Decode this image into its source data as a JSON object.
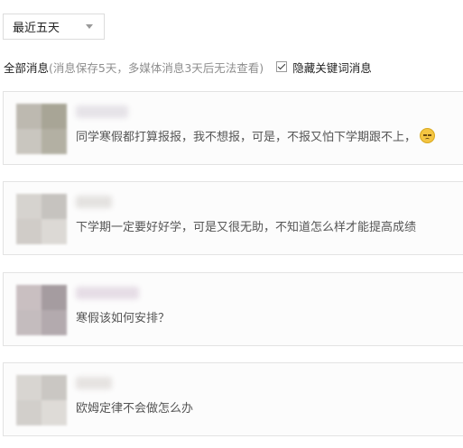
{
  "filter": {
    "time_range": "最近五天",
    "all_messages_label": "全部消息",
    "retention_note": "(消息保存5天，多媒体消息3天后无法查看)",
    "hide_keyword_label": "隐藏关键词消息",
    "hide_keyword_checked": true
  },
  "messages": [
    {
      "text": "同学寒假都打算报报，我不想报，可是，不报又怕下学期跟不上，",
      "emoji": "pensive-face-icon"
    },
    {
      "text": "下学期一定要好好学，可是又很无助，不知道怎么样才能提高成绩",
      "emoji": ""
    },
    {
      "text": "寒假该如何安排？",
      "emoji": ""
    },
    {
      "text": "欧姆定律不会做怎么办",
      "emoji": ""
    }
  ]
}
